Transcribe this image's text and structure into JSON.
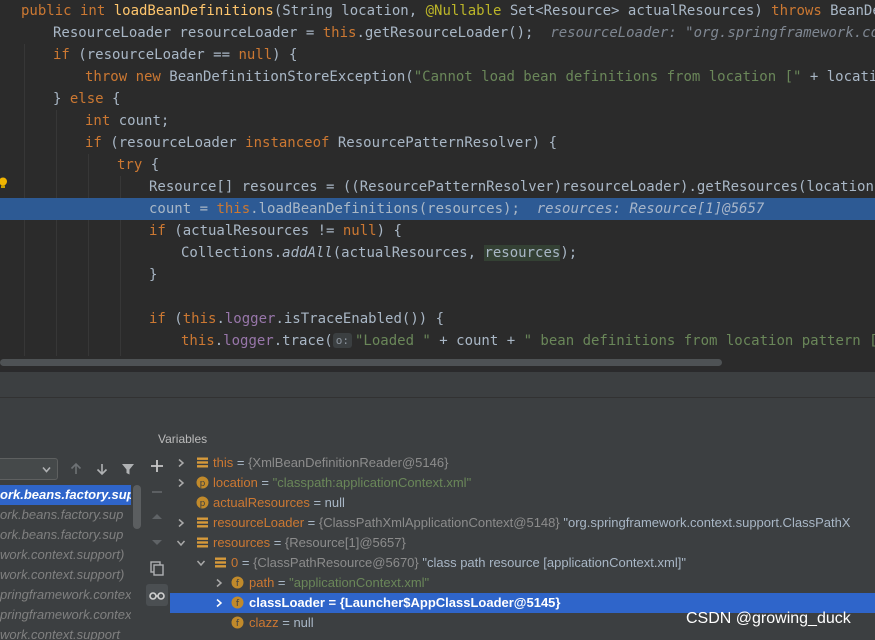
{
  "editor": {
    "line1": {
      "kw1": "public int ",
      "method": "loadBeanDefinitions",
      "p1": "(String location, ",
      "annot": "@Nullable",
      "p2": " Set<Resource> actualResources) ",
      "kw2": "throws",
      "p3": " BeanDefinit"
    },
    "line2": {
      "code": "ResourceLoader resourceLoader = ",
      "kw": "this",
      "code2": ".getResourceLoader();",
      "hint": "resourceLoader: \"org.springframework.context"
    },
    "line3": {
      "kw": "if",
      "code": " (resourceLoader == ",
      "kw2": "null",
      "code2": ") {"
    },
    "line4": {
      "kw": "throw new",
      "code": " BeanDefinitionStoreException(",
      "str": "\"Cannot load bean definitions from location [\"",
      "code2": " + location +"
    },
    "line5": {
      "code": "} ",
      "kw": "else",
      "code2": " {"
    },
    "line6": {
      "kw": "int",
      "code": " count;"
    },
    "line7": {
      "kw": "if",
      "code": " (resourceLoader ",
      "kw2": "instanceof",
      "code2": " ResourcePatternResolver) {"
    },
    "line8": {
      "kw": "try",
      "code": " {"
    },
    "line9": {
      "code": "Resource[] resources = ((ResourcePatternResolver)resourceLoader).getResources(location);"
    },
    "line10": {
      "code": "count = ",
      "kw": "this",
      "code2": ".loadBeanDefinitions(resources);",
      "hint": "resources: Resource[1]@5657"
    },
    "line11": {
      "kw": "if",
      "code": " (actualResources != ",
      "kw2": "null",
      "code2": ") {"
    },
    "line12": {
      "code": "Collections.",
      "static": "addAll",
      "code2": "(actualResources, ",
      "res": "resources",
      "code3": ");"
    },
    "line13": {
      "code": "}"
    },
    "line15": {
      "kw": "if",
      "code": " (",
      "kw2": "this",
      "code2": ".",
      "fld": "logger",
      "code3": ".isTraceEnabled()) {"
    },
    "line16": {
      "kw": "this",
      "code": ".",
      "fld": "logger",
      "code2": ".trace(",
      "chip": "o:",
      "str": "\"Loaded \"",
      "code3": " + count + ",
      "str2": "\" bean definitions from location pattern [\"",
      "code4": " +"
    }
  },
  "frames": {
    "items": [
      "ork.beans.factory.sup",
      "ork.beans.factory.sup",
      "ork.beans.factory.sup",
      "work.context.support)",
      "work.context.support)",
      "pringframework.contex",
      "pringframework.contex",
      "work.context.support"
    ]
  },
  "variables": {
    "title": "Variables",
    "rows": [
      {
        "name": "this",
        "eq": " = ",
        "type": "{XmlBeanDefinitionReader@5146}",
        "val": ""
      },
      {
        "name": "location",
        "eq": " = ",
        "str": "\"classpath:applicationContext.xml\""
      },
      {
        "name": "actualResources",
        "eq": " = ",
        "val": "null"
      },
      {
        "name": "resourceLoader",
        "eq": " = ",
        "type": "{ClassPathXmlApplicationContext@5148}",
        "val": " \"org.springframework.context.support.ClassPathX"
      },
      {
        "name": "resources",
        "eq": " = ",
        "type": "{Resource[1]@5657}"
      },
      {
        "name": "0",
        "eq": " = ",
        "type": "{ClassPathResource@5670}",
        "val": " \"class path resource [applicationContext.xml]\""
      },
      {
        "name": "path",
        "eq": " = ",
        "str": "\"applicationContext.xml\""
      },
      {
        "name": "classLoader",
        "eq": " = ",
        "val": "{Launcher$AppClassLoader@5145}"
      },
      {
        "name": "clazz",
        "eq": " = ",
        "val": "null"
      }
    ]
  },
  "watermark": "CSDN @growing_duck",
  "colors": {
    "keyword": "#cc7832",
    "string": "#6a8759",
    "selection": "#2f65ca",
    "exec_line": "#2d5a94"
  }
}
